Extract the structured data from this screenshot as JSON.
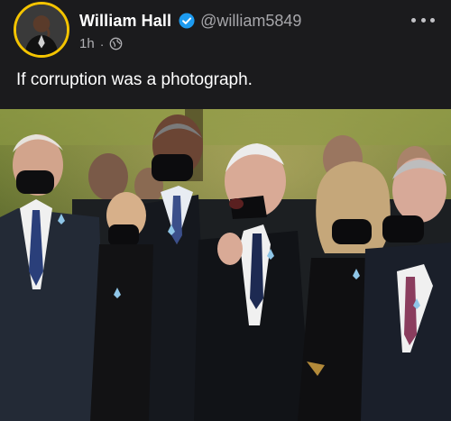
{
  "post": {
    "author": {
      "name": "William Hall",
      "handle": "@william5849",
      "verified": true,
      "avatar_icon": "avatar-photo-icon"
    },
    "meta": {
      "time": "1h",
      "separator": "·",
      "privacy_icon": "globe-icon"
    },
    "more_icon": "more-options-icon",
    "text": "If corruption was a photograph.",
    "photo": {
      "icon": "photograph",
      "description_hidden": true
    }
  },
  "colors": {
    "background": "#1b1b1d",
    "avatar_ring": "#f4c400",
    "verified": "#1d9bf0",
    "secondary_text": "#a6a6aa"
  }
}
